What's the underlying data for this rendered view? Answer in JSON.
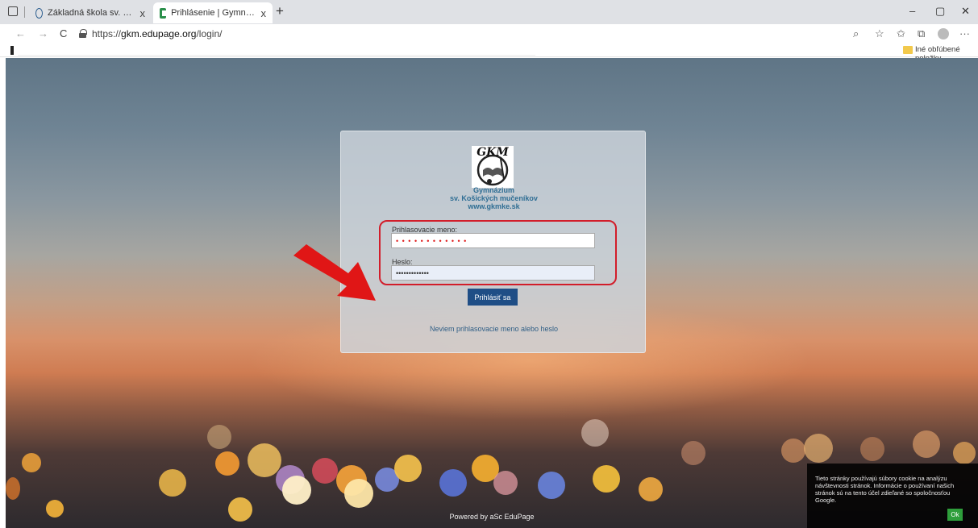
{
  "browser": {
    "tabs": [
      {
        "title": "Základná škola sv. Košických mu...",
        "close": "x"
      },
      {
        "title": "Prihlásenie | Gymnázium sv. Koš...",
        "close": "x"
      }
    ],
    "new_tab": "+",
    "window_controls": {
      "minimize": "–",
      "maximize": "▢",
      "close": "✕"
    },
    "nav": {
      "back": "←",
      "forward": "→",
      "refresh": "C"
    },
    "url_prefix": "https://",
    "url_host": "gkm.edupage.org",
    "url_path": "/login/",
    "toolbar_icons": {
      "search": "⌕",
      "favorite": "☆",
      "favorites": "✩",
      "collections": "⧉",
      "more": "···"
    },
    "favorites_folder": "Iné obľúbené položky"
  },
  "login": {
    "logo_text": "GKM",
    "school_line1": "Gymnázium",
    "school_line2": "sv. Košických mučeníkov",
    "school_line3": "www.gkmke.sk",
    "username_label": "Prihlasovacie meno:",
    "username_value": "• • • • • • • • • • • •",
    "password_label": "Heslo:",
    "password_value": "•••••••••••••",
    "login_button": "Prihlásiť sa",
    "forgot_link": "Neviem prihlasovacie meno alebo heslo"
  },
  "footer": {
    "powered_by": "Powered by aSc EduPage"
  },
  "cookie": {
    "text": "Tieto stránky používajú súbory cookie na analýzu návštevnosti stránok. Informácie o používaní našich stránok sú na tento účel zdieľané so spoločnosťou Google.",
    "ok": "Ok"
  },
  "colors": {
    "accent": "#1f4e86",
    "highlight": "#d21d2a",
    "link": "#2f5e86",
    "cookie_ok": "#2e9e3b"
  }
}
